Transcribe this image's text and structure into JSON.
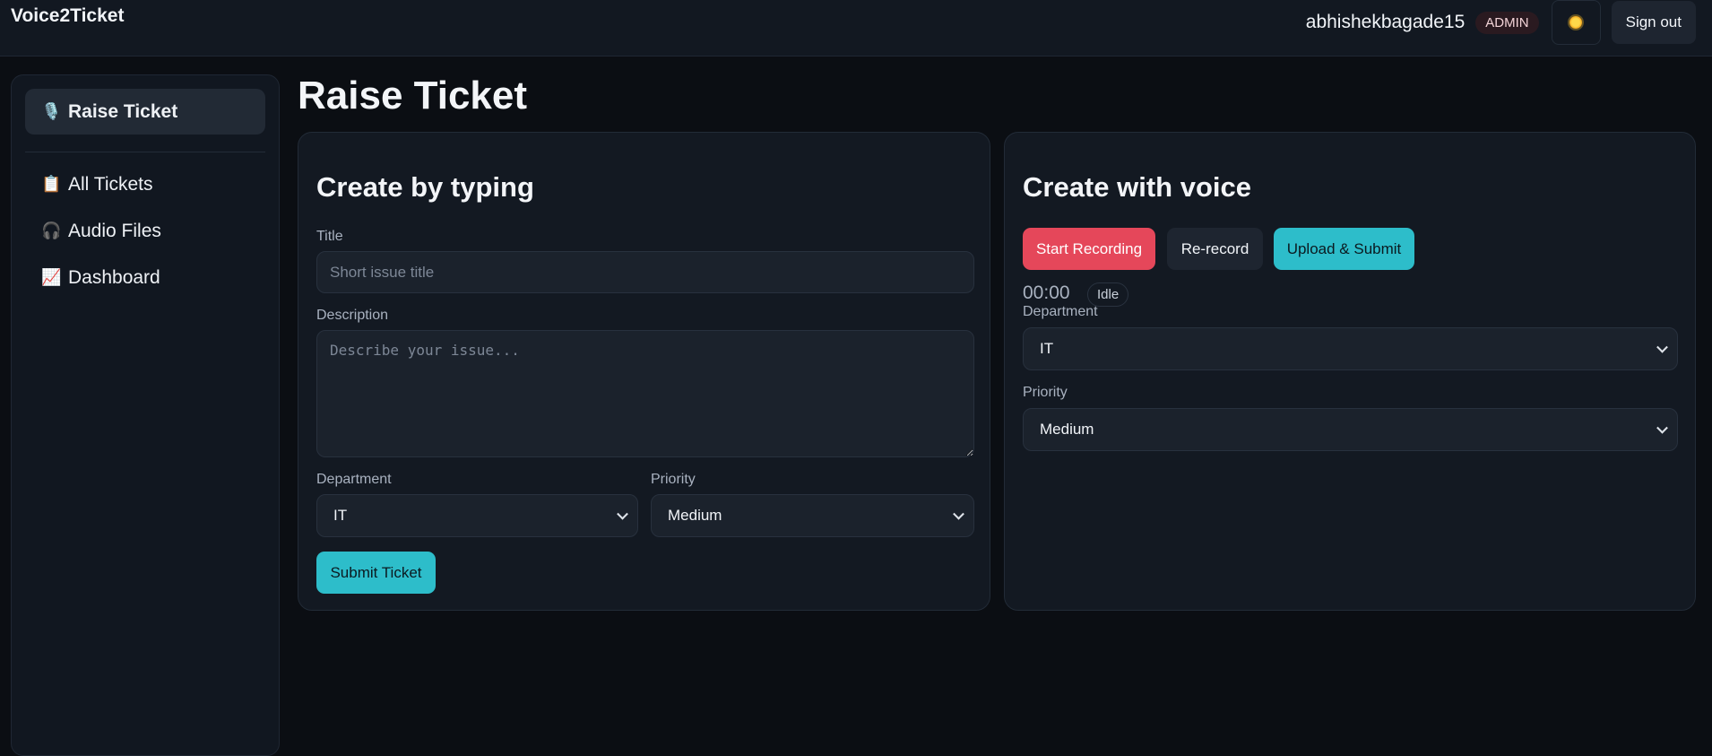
{
  "app": {
    "brand": "Voice2Ticket",
    "username": "abhishekbagade15",
    "role": "ADMIN",
    "sign_out_label": "Sign out",
    "theme_icon": "sun-icon"
  },
  "sidebar": {
    "items": [
      {
        "icon": "🎙️",
        "label": "Raise Ticket",
        "active": true
      },
      {
        "icon": "📋",
        "label": "All Tickets",
        "active": false
      },
      {
        "icon": "🎧",
        "label": "Audio Files",
        "active": false
      },
      {
        "icon": "📈",
        "label": "Dashboard",
        "active": false
      }
    ]
  },
  "main": {
    "page_title": "Raise Ticket",
    "typing": {
      "title": "Create by typing",
      "title_label": "Title",
      "title_placeholder": "Short issue title",
      "description_label": "Description",
      "description_placeholder": "Describe your issue...",
      "department_label": "Department",
      "department_value": "IT",
      "priority_label": "Priority",
      "priority_value": "Medium",
      "submit_label": "Submit Ticket"
    },
    "voice": {
      "title": "Create with voice",
      "start_label": "Start Recording",
      "rerecord_label": "Re-record",
      "upload_label": "Upload & Submit",
      "timer": "00:00",
      "status": "Idle",
      "department_label": "Department",
      "department_value": "IT",
      "priority_label": "Priority",
      "priority_value": "Medium"
    }
  },
  "colors": {
    "background": "#0b0e13",
    "panel": "#131922",
    "accent_teal": "#2dbdca",
    "accent_red": "#e5475a"
  }
}
